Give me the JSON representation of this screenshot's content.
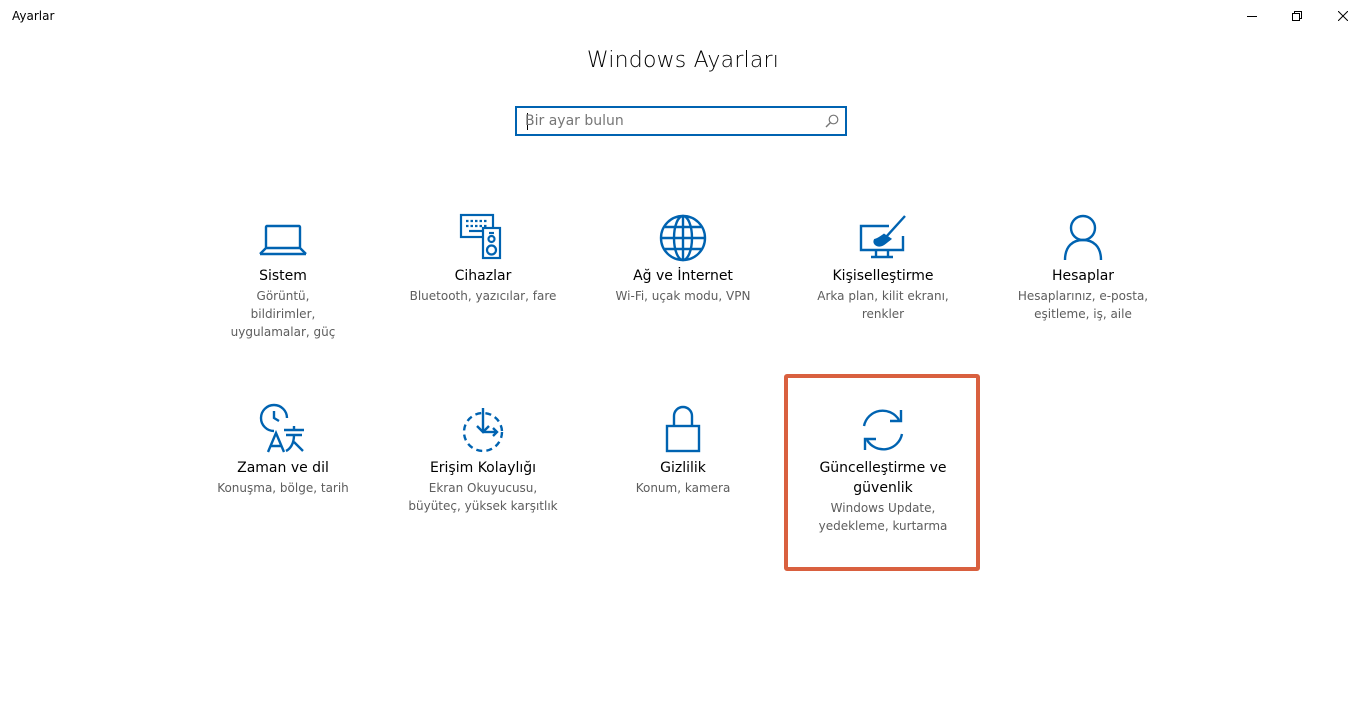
{
  "window": {
    "title": "Ayarlar"
  },
  "page": {
    "title": "Windows Ayarları"
  },
  "search": {
    "placeholder": "Bir ayar bulun",
    "value": ""
  },
  "tiles": [
    {
      "label": "Sistem",
      "desc": "Görüntü, bildirimler, uygulamalar, güç",
      "icon": "laptop-icon"
    },
    {
      "label": "Cihazlar",
      "desc": "Bluetooth, yazıcılar, fare",
      "icon": "devices-icon"
    },
    {
      "label": "Ağ ve İnternet",
      "desc": "Wi-Fi, uçak modu, VPN",
      "icon": "globe-icon"
    },
    {
      "label": "Kişiselleştirme",
      "desc": "Arka plan, kilit ekranı, renkler",
      "icon": "paint-icon"
    },
    {
      "label": "Hesaplar",
      "desc": "Hesaplarınız, e-posta, eşitleme, iş, aile",
      "icon": "person-icon"
    },
    {
      "label": "Zaman ve dil",
      "desc": "Konuşma, bölge, tarih",
      "icon": "time-language-icon"
    },
    {
      "label": "Erişim Kolaylığı",
      "desc": "Ekran Okuyucusu, büyüteç, yüksek karşıtlık",
      "icon": "accessibility-icon"
    },
    {
      "label": "Gizlilik",
      "desc": "Konum, kamera",
      "icon": "lock-icon"
    },
    {
      "label": "Güncelleştirme ve güvenlik",
      "desc": "Windows Update, yedekleme, kurtarma",
      "icon": "sync-icon"
    }
  ],
  "colors": {
    "accent": "#0063b1",
    "highlight": "#d9603f",
    "desc_text": "#5d5d5d"
  }
}
